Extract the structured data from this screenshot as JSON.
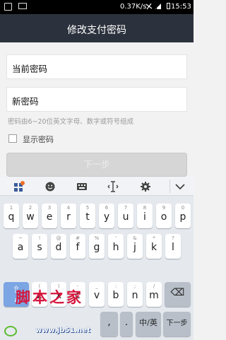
{
  "status_bar": {
    "speed": "0.37K/s",
    "time": "15:53",
    "icons": [
      "notification-icon",
      "screenshot-icon",
      "mute-icon",
      "signal-icon",
      "battery-icon"
    ]
  },
  "title_bar": {
    "title": "修改支付密码"
  },
  "form": {
    "current_password_label": "当前密码",
    "new_password_label": "新密码",
    "hint": "密码由6~20位英文字母、数字或符号组成",
    "show_password_label": "显示密码",
    "show_password_checked": false,
    "next_button_label": "下一步"
  },
  "keyboard": {
    "toolbar_icons": [
      "grid-icon",
      "emoji-icon",
      "keyboard-icon",
      "cursor-icon",
      "settings-icon",
      "collapse-icon"
    ],
    "row1": [
      {
        "main": "q",
        "sub": "1"
      },
      {
        "main": "w",
        "sub": "2"
      },
      {
        "main": "e",
        "sub": "3"
      },
      {
        "main": "r",
        "sub": "4"
      },
      {
        "main": "t",
        "sub": "5"
      },
      {
        "main": "y",
        "sub": "6"
      },
      {
        "main": "u",
        "sub": "7"
      },
      {
        "main": "i",
        "sub": "8"
      },
      {
        "main": "o",
        "sub": "9"
      },
      {
        "main": "p",
        "sub": "0"
      }
    ],
    "row2": [
      {
        "main": "a",
        "sub": "~"
      },
      {
        "main": "s",
        "sub": "!"
      },
      {
        "main": "d",
        "sub": "@"
      },
      {
        "main": "f",
        "sub": "#"
      },
      {
        "main": "g",
        "sub": "%"
      },
      {
        "main": "h",
        "sub": "'"
      },
      {
        "main": "j",
        "sub": "&"
      },
      {
        "main": "k",
        "sub": "*"
      },
      {
        "main": "l",
        "sub": "?"
      }
    ],
    "row3": [
      {
        "main": "z",
        "sub": "("
      },
      {
        "main": "x",
        "sub": ")"
      },
      {
        "main": "c",
        "sub": "-"
      },
      {
        "main": "v",
        "sub": "_"
      },
      {
        "main": "b",
        "sub": ":"
      },
      {
        "main": "n",
        "sub": ";"
      },
      {
        "main": "m",
        "sub": "/"
      }
    ],
    "shift": {
      "main": "⇧",
      "sub": "a"
    },
    "backspace": "⌫",
    "bottom": {
      "comma": ",",
      "period": ".",
      "lang": "中/英",
      "next": "下一步"
    }
  },
  "watermark": {
    "text": "脚本之家",
    "url": "www.jb51.net"
  }
}
